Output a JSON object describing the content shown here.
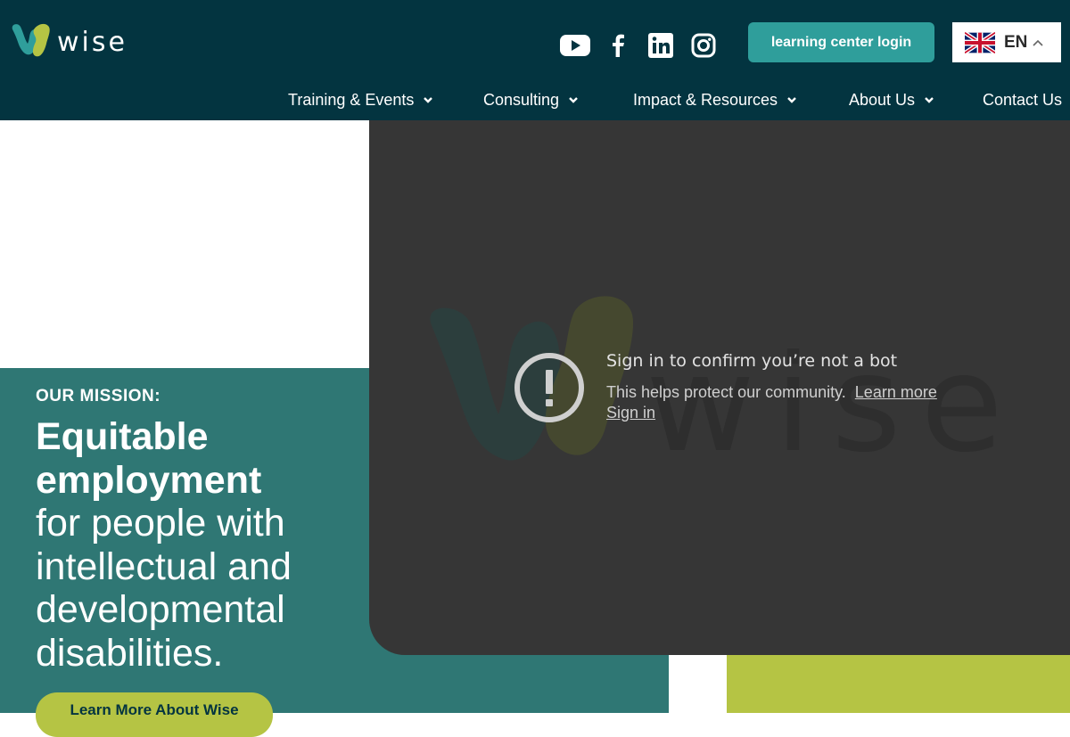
{
  "brand": {
    "name": "wise",
    "teal": "#2f9e9b",
    "lime": "#b5c444",
    "navy": "#033440",
    "mission_bg": "#2f7774"
  },
  "header": {
    "social_icons": [
      "youtube-icon",
      "facebook-icon",
      "linkedin-icon",
      "instagram-icon"
    ],
    "login_label": "learning center login",
    "language": {
      "code": "EN",
      "flag": "uk-flag-icon"
    }
  },
  "nav": {
    "items": [
      {
        "label": "Training & Events",
        "dropdown": true
      },
      {
        "label": "Consulting",
        "dropdown": true
      },
      {
        "label": "Impact & Resources",
        "dropdown": true
      },
      {
        "label": "About Us",
        "dropdown": true
      },
      {
        "label": "Contact Us",
        "dropdown": false
      }
    ]
  },
  "hero": {
    "mission_label": "OUR MISSION:",
    "headline_strong": "Equitable employment",
    "headline_rest": "for people with intellectual and developmental disabilities.",
    "cta_label": "Learn More About Wise"
  },
  "video": {
    "title": "Sign in to confirm you’re not a bot",
    "body": "This helps protect our community.",
    "learn_more": "Learn more",
    "sign_in": "Sign in",
    "background_watermark": "wise"
  }
}
